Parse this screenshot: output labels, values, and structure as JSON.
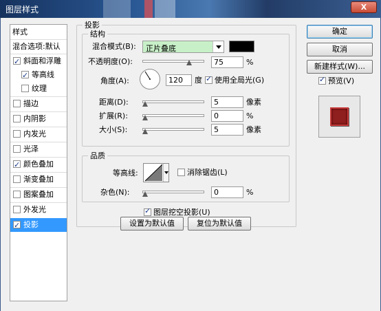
{
  "window": {
    "title": "图层样式",
    "close_label": "X"
  },
  "styles_list": {
    "items": [
      {
        "label": "样式",
        "type": "header"
      },
      {
        "label": "混合选项:默认",
        "type": "header"
      },
      {
        "label": "斜面和浮雕",
        "checked": true
      },
      {
        "label": "等高线",
        "checked": true,
        "sub": true
      },
      {
        "label": "纹理",
        "checked": false,
        "sub": true
      },
      {
        "label": "描边",
        "checked": false
      },
      {
        "label": "内阴影",
        "checked": false
      },
      {
        "label": "内发光",
        "checked": false
      },
      {
        "label": "光泽",
        "checked": false
      },
      {
        "label": "颜色叠加",
        "checked": true
      },
      {
        "label": "渐变叠加",
        "checked": false
      },
      {
        "label": "图案叠加",
        "checked": false
      },
      {
        "label": "外发光",
        "checked": false
      },
      {
        "label": "投影",
        "checked": true,
        "selected": true
      }
    ]
  },
  "drop_shadow": {
    "title": "投影",
    "structure": {
      "title": "结构",
      "blend_mode_label": "混合模式(B):",
      "blend_mode_value": "正片叠底",
      "shadow_color": "#000000",
      "opacity_label": "不透明度(O):",
      "opacity_value": "75",
      "opacity_unit": "%",
      "opacity_level": 0.75,
      "angle_label": "角度(A):",
      "angle_value": "120",
      "angle_unit": "度",
      "global_light_label": "使用全局光(G)",
      "global_light_checked": true,
      "distance_label": "距离(D):",
      "distance_value": "5",
      "distance_unit": "像素",
      "spread_label": "扩展(R):",
      "spread_value": "0",
      "spread_unit": "%",
      "size_label": "大小(S):",
      "size_value": "5",
      "size_unit": "像素"
    },
    "quality": {
      "title": "品质",
      "contour_label": "等高线:",
      "anti_alias_label": "消除锯齿(L)",
      "anti_alias_checked": false,
      "noise_label": "杂色(N):",
      "noise_value": "0",
      "noise_unit": "%"
    },
    "knockout_label": "图层挖空投影(U)",
    "knockout_checked": true,
    "make_default_label": "设置为默认值",
    "reset_default_label": "复位为默认值"
  },
  "buttons": {
    "ok": "确定",
    "cancel": "取消",
    "new_style": "新建样式(W)...",
    "preview_label": "预览(V)",
    "preview_checked": true
  },
  "colors": {
    "selection": "#3399ff",
    "blend_field": "#c8f0c8",
    "preview_swatch": "#8f1e1e"
  }
}
